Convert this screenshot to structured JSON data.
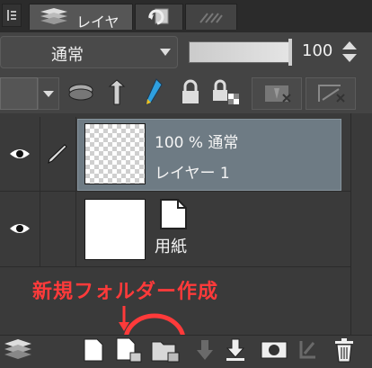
{
  "panel": {
    "tab_layer_label": "レイヤー",
    "tab_icons": [
      "layers-icon",
      "undo-history-icon",
      "material-icon"
    ]
  },
  "blend": {
    "mode": "通常",
    "opacity": "100"
  },
  "toolbar": {
    "icons": [
      "color-square-icon",
      "dropdown-icon",
      "clip-mask-icon",
      "reference-layer-icon",
      "draft-pen-icon",
      "lock-icon",
      "lock-transparent-icon",
      "mask-icon",
      "delete-mask-icon"
    ]
  },
  "layers": [
    {
      "opacity_mode": "100 % 通常",
      "name": "レイヤー 1",
      "visible": true,
      "selected": true
    },
    {
      "name": "用紙",
      "visible": true,
      "selected": false
    }
  ],
  "annotation": {
    "text": "新規フォルダー作成"
  },
  "colors": {
    "selected_row": "#6e7b84",
    "annotation": "#ff3a3a"
  }
}
